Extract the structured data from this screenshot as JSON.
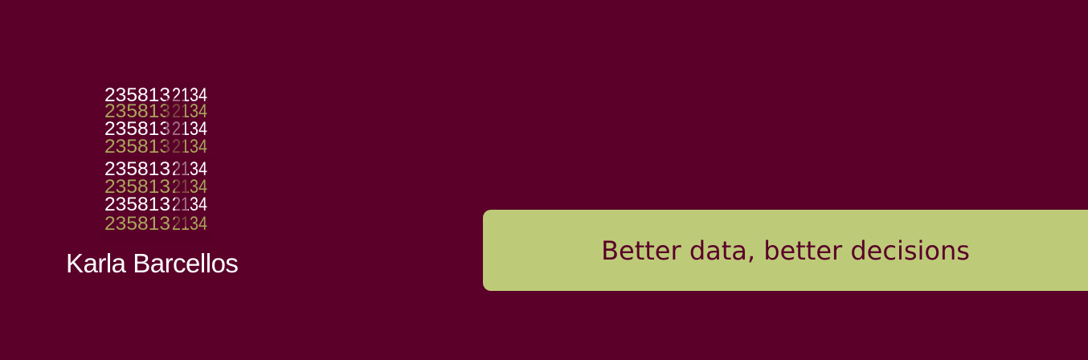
{
  "colors": {
    "background": "#5a0029",
    "accent": "#bdcb78",
    "logo_white": "#ffffff",
    "logo_olive": "#a9a55b",
    "tagline_text": "#5a0029",
    "brand_text": "#ffffff"
  },
  "logo": {
    "icon": "fibonacci-digits-logo-icon",
    "rows": [
      {
        "digits": "2358132134",
        "color": "white"
      },
      {
        "digits": "2358132134",
        "color": "olive"
      },
      {
        "digits": "2358132134",
        "color": "white"
      },
      {
        "digits": "2358132134",
        "color": "olive"
      },
      {
        "digits": "2358132134",
        "color": "white"
      },
      {
        "digits": "2358132134",
        "color": "olive"
      },
      {
        "digits": "2358132134",
        "color": "white"
      },
      {
        "digits": "2358132134",
        "color": "olive"
      }
    ]
  },
  "brand": {
    "name": "Karla Barcellos"
  },
  "tagline": {
    "text": "Better data, better decisions"
  }
}
